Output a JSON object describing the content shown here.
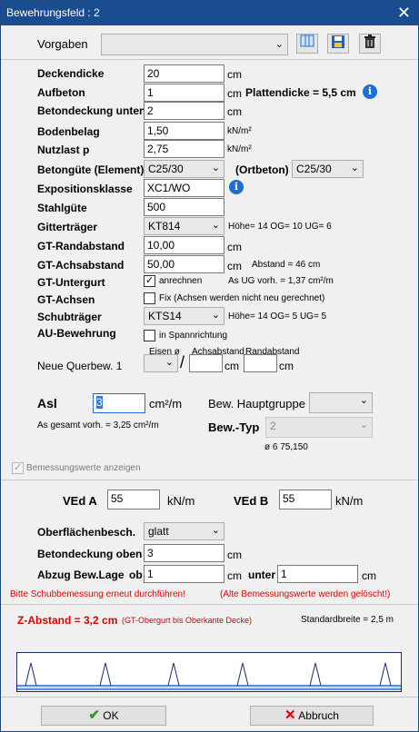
{
  "window": {
    "title": "Bewehrungsfeld : 2",
    "close": "✕"
  },
  "vorgaben": {
    "label": "Vorgaben",
    "value": ""
  },
  "fields": {
    "deckendicke": {
      "label": "Deckendicke",
      "value": "20",
      "unit": "cm"
    },
    "aufbeton": {
      "label": "Aufbeton",
      "value": "1",
      "unit": "cm",
      "plattendicke": "Plattendicke = 5,5 cm"
    },
    "betondeckung_unten": {
      "label": "Betondeckung unten",
      "value": "2",
      "unit": "cm"
    },
    "bodenbelag": {
      "label": "Bodenbelag",
      "value": "1,50",
      "unit": "kN/m²"
    },
    "nutzlast": {
      "label": "Nutzlast p",
      "value": "2,75",
      "unit": "kN/m²"
    },
    "betonguete": {
      "label": "Betongüte (Element)",
      "value": "C25/30",
      "ortbeton_label": "(Ortbeton)",
      "ortbeton_value": "C25/30"
    },
    "expositionsklasse": {
      "label": "Expositionsklasse",
      "value": "XC1/WO"
    },
    "stahlguete": {
      "label": "Stahlgüte",
      "value": "500"
    },
    "gittertraeger": {
      "label": "Gitterträger",
      "value": "KT814",
      "info": "Höhe= 14  OG= 10  UG= 6"
    },
    "gt_randabstand": {
      "label": "GT-Randabstand",
      "value": "10,00",
      "unit": "cm"
    },
    "gt_achsabstand": {
      "label": "GT-Achsabstand",
      "value": "50,00",
      "unit": "cm",
      "info": "Abstand = 46 cm"
    },
    "gt_untergurt": {
      "label": "GT-Untergurt",
      "checkbox": "anrechnen",
      "checked": true,
      "info": "As UG vorh. = 1,37 cm²/m"
    },
    "gt_achsen": {
      "label": "GT-Achsen",
      "checkbox": "Fix (Achsen werden nicht neu gerechnet)",
      "checked": false
    },
    "schubtraeger": {
      "label": "Schubträger",
      "value": "KTS14",
      "info": "Höhe= 14  OG= 5  UG= 5"
    },
    "au_bewehrung": {
      "label": "AU-Bewehrung",
      "checkbox": "in Spannrichtung",
      "checked": false
    }
  },
  "querbew": {
    "label": "Neue Querbew. 1",
    "col_eisen": "Eisen ø",
    "col_achsabstand": "Achsabstand",
    "col_randabstand": "Randabstand",
    "slash": "/",
    "unit1": "cm",
    "unit2": "cm",
    "achs_value": "",
    "rand_value": ""
  },
  "asl": {
    "label": "Asl",
    "value": "3",
    "unit": "cm²/m",
    "gesamt": "As gesamt vorh. = 3,25 cm²/m",
    "hauptgruppe_label": "Bew. Hauptgruppe",
    "hauptgruppe_value": "",
    "typ_label": "Bew.-Typ",
    "typ_value": "2",
    "typ_info": "ø 6  75,150"
  },
  "bemessung": {
    "label": "Bemessungswerte anzeigen",
    "checked": true
  },
  "loads": {
    "ved_a_label": "VEd A",
    "ved_a_value": "55",
    "ved_a_unit": "kN/m",
    "ved_b_label": "VEd B",
    "ved_b_value": "55",
    "ved_b_unit": "kN/m"
  },
  "lower": {
    "oberflaeche_label": "Oberflächenbesch.",
    "oberflaeche_value": "glatt",
    "betondeckung_oben_label": "Betondeckung oben",
    "betondeckung_oben_value": "3",
    "betondeckung_oben_unit": "cm",
    "abzug_label": "Abzug Bew.Lage",
    "ob_label": "ob",
    "ob_value": "1",
    "ob_unit": "cm",
    "unter_label": "unter",
    "unter_value": "1",
    "unter_unit": "cm"
  },
  "warnings": {
    "left": "Bitte Schubbemessung erneut durchführen!",
    "right": "(Alte Bemessungswerte werden gelöscht!)"
  },
  "zabstand": {
    "label": "Z-Abstand = 3,2 cm",
    "note": "(GT-Obergurt bis Oberkante Decke)",
    "standardbreite": "Standardbreite = 2,5 m"
  },
  "buttons": {
    "ok": "OK",
    "cancel": "Abbruch"
  },
  "colors": {
    "title_bar": "#1a4d8f",
    "warning": "#dd0000",
    "accent": "#1f6fd0"
  }
}
